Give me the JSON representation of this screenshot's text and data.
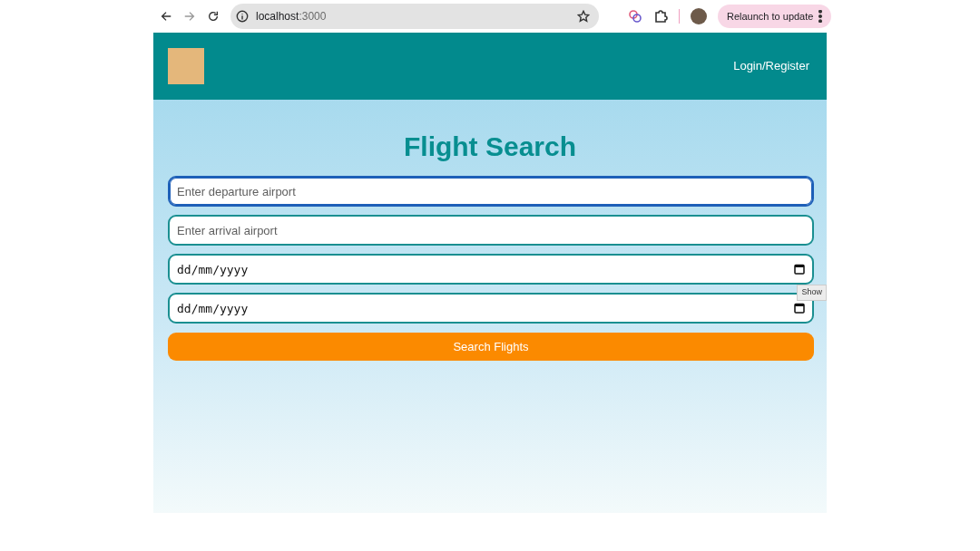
{
  "browser": {
    "address_host": "localhost",
    "address_port": ":3000",
    "relaunch_label": "Relaunch to update"
  },
  "navbar": {
    "login_link": "Login/Register"
  },
  "title": "Flight Search",
  "fields": [
    {
      "kind": "text",
      "placeholder": "Enter departure airport",
      "focused": true
    },
    {
      "kind": "text",
      "placeholder": "Enter arrival airport",
      "focused": false
    },
    {
      "kind": "date",
      "placeholder": "dd/mm/yyyy",
      "focused": false,
      "tooltip": "Show"
    },
    {
      "kind": "date",
      "placeholder": "dd/mm/yyyy",
      "focused": false
    }
  ],
  "search_button": "Search Flights"
}
